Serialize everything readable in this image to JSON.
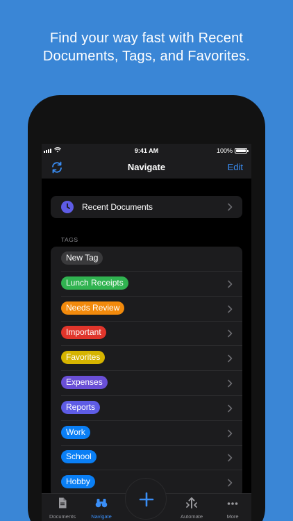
{
  "headline": {
    "line1": "Find your way fast with Recent",
    "line2": "Documents, Tags, and Favorites."
  },
  "status_bar": {
    "time": "9:41 AM",
    "battery": "100%"
  },
  "navbar": {
    "title": "Navigate",
    "edit_label": "Edit",
    "left_icon": "sync-icon"
  },
  "recent": {
    "label": "Recent Documents",
    "icon": "clock-icon",
    "icon_color": "#5e5ce6"
  },
  "tags_section": {
    "header": "TAGS",
    "tags": [
      {
        "label": "New Tag",
        "color": "#3a3a3c",
        "has_chevron": false
      },
      {
        "label": "Lunch Receipts",
        "color": "#30b350",
        "has_chevron": true
      },
      {
        "label": "Needs Review",
        "color": "#f28a0c",
        "has_chevron": true
      },
      {
        "label": "Important",
        "color": "#e0352b",
        "has_chevron": true
      },
      {
        "label": "Favorites",
        "color": "#d6b400",
        "has_chevron": true
      },
      {
        "label": "Expenses",
        "color": "#6a4fd6",
        "has_chevron": true
      },
      {
        "label": "Reports",
        "color": "#5e5ce6",
        "has_chevron": true
      },
      {
        "label": "Work",
        "color": "#0a7ff5",
        "has_chevron": true
      },
      {
        "label": "School",
        "color": "#0a7ff5",
        "has_chevron": true
      },
      {
        "label": "Hobby",
        "color": "#0a7ff5",
        "has_chevron": true
      }
    ]
  },
  "fab": {
    "icon": "plus-icon"
  },
  "tab_bar": {
    "tabs": [
      {
        "label": "Documents",
        "icon": "document-icon",
        "active": false
      },
      {
        "label": "Navigate",
        "icon": "binoculars-icon",
        "active": true
      },
      {
        "label": "Automate",
        "icon": "automate-icon",
        "active": false
      },
      {
        "label": "More",
        "icon": "ellipsis-icon",
        "active": false
      }
    ]
  },
  "colors": {
    "background": "#3a86d6",
    "accent": "#3a8ef6"
  }
}
